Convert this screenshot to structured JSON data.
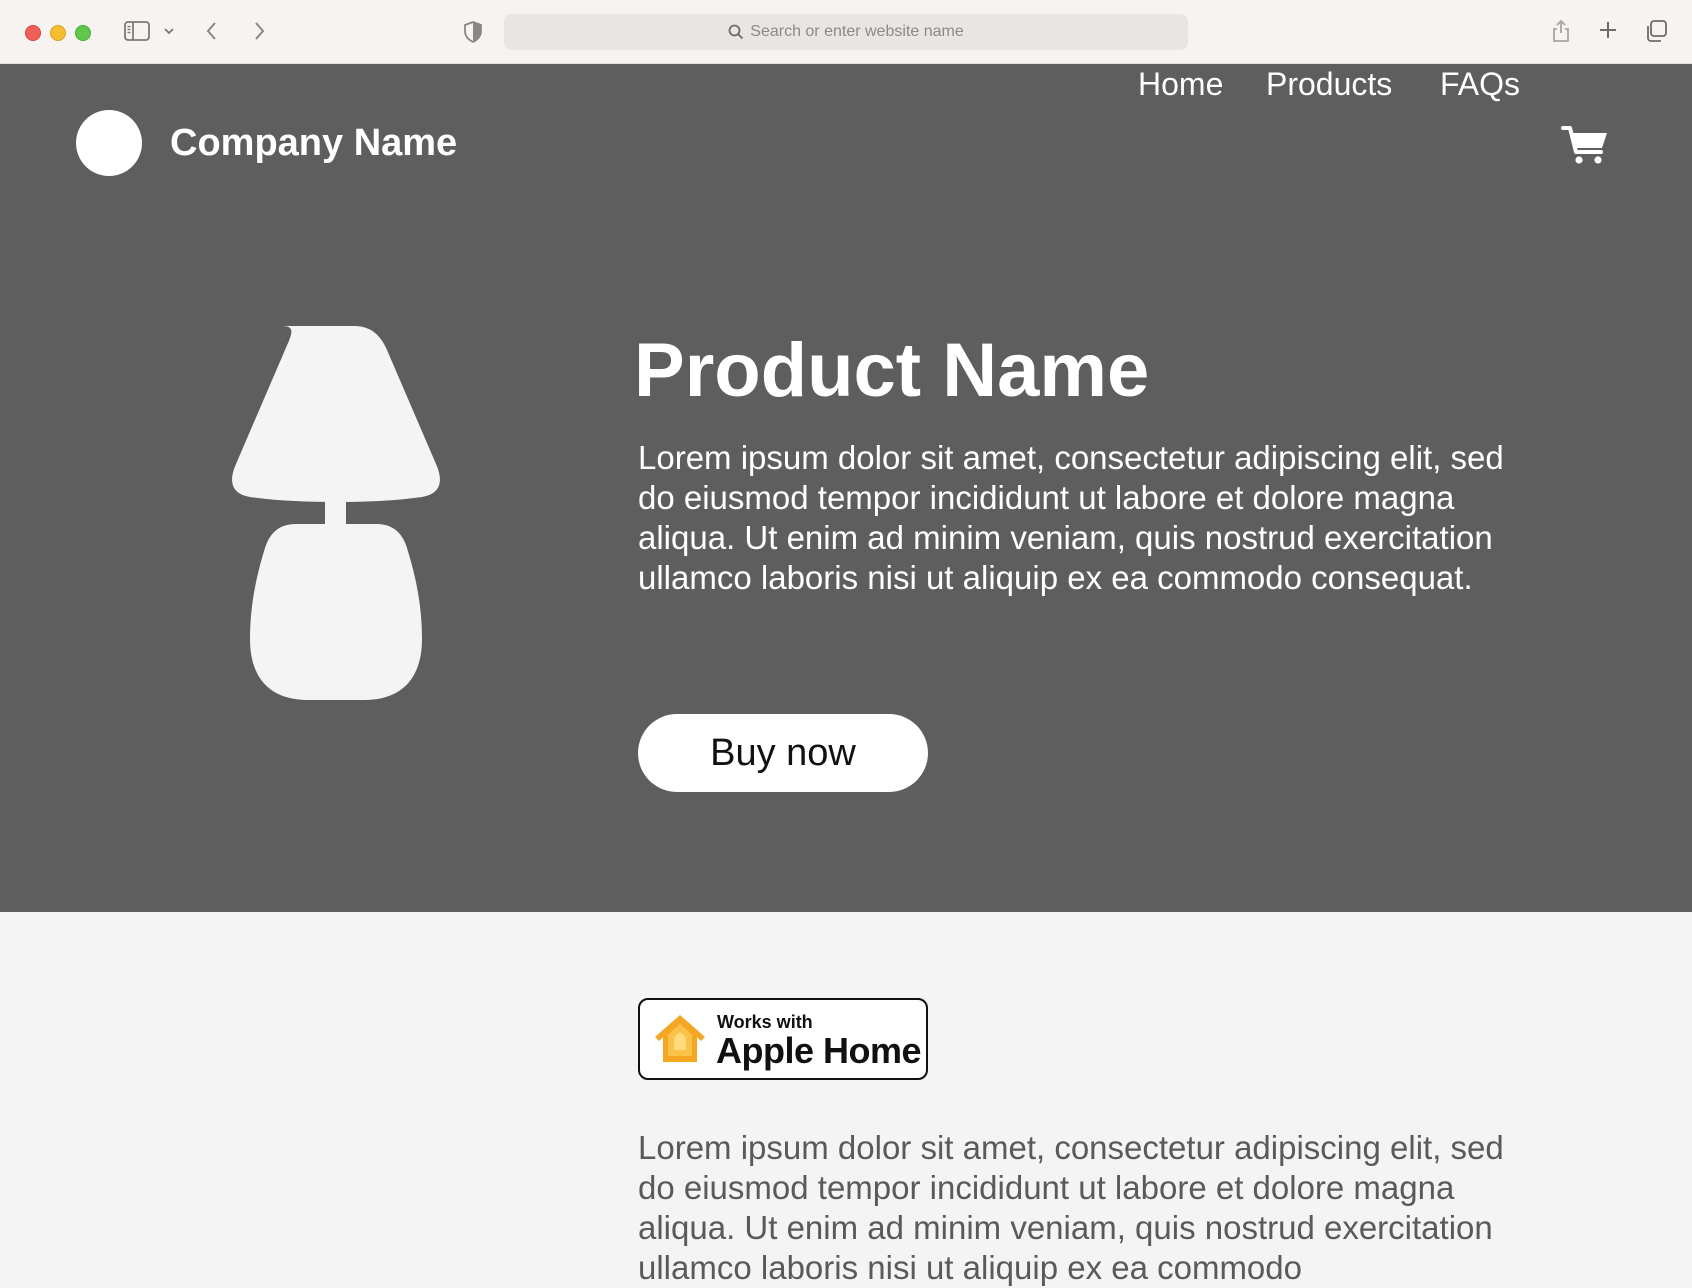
{
  "browser": {
    "search_placeholder": "Search or enter website name",
    "icons": [
      "sidebar-icon",
      "chevron-down-icon",
      "back-icon",
      "forward-icon",
      "privacy-shield-icon",
      "search-icon",
      "share-icon",
      "new-tab-icon",
      "tab-overview-icon"
    ]
  },
  "header": {
    "company_name": "Company Name",
    "nav": [
      {
        "label": "Home"
      },
      {
        "label": "Products"
      },
      {
        "label": "FAQs"
      }
    ],
    "cart_icon": "cart-icon"
  },
  "hero": {
    "product_title": "Product Name",
    "description": "Lorem ipsum dolor sit amet, consectetur adipiscing elit, sed do eiusmod tempor incididunt ut labore et dolore magna aliqua. Ut enim ad minim veniam, quis nostrud exercitation ullamco laboris nisi ut aliquip ex ea commodo consequat.",
    "buy_label": "Buy now",
    "image_icon": "lamp-icon"
  },
  "details": {
    "badge_line1": "Works with",
    "badge_line2": "Apple Home",
    "description": "Lorem ipsum dolor sit amet, consectetur adipiscing elit, sed do eiusmod tempor incididunt ut labore et dolore magna aliqua. Ut enim ad minim veniam, quis nostrud exercitation ullamco laboris nisi ut aliquip ex ea commodo"
  },
  "colors": {
    "hero_bg": "#5e5e5e",
    "page_bg": "#f4f4f4",
    "chrome_bg": "#f7f3f0",
    "badge_house": "#f5a623"
  }
}
